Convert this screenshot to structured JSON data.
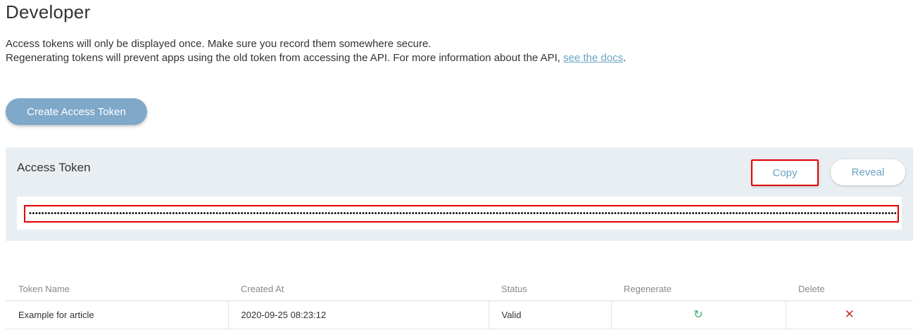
{
  "page": {
    "title": "Developer"
  },
  "intro": {
    "line1": "Access tokens will only be displayed once. Make sure you record them somewhere secure.",
    "line2_prefix": "Regenerating tokens will prevent apps using the old token from accessing the API. For more information about the API, ",
    "docs_link": "see the docs",
    "line2_suffix": "."
  },
  "create_button": {
    "label": "Create Access Token"
  },
  "token_panel": {
    "title": "Access Token",
    "copy_label": "Copy",
    "reveal_label": "Reveal",
    "masked_token": "•••••••••••••••••••••••••••••••••••••••••••••••••••••••••••••••••••••••••••••••••••••••••••••••••••••••••••••••••••••••••••••••••••••••••••••••••••••••••••••••••••••••••••••••••••••••••••••••••••••••••••••••••••••••••••••••••••••••••••••••••••••••••••••••••••••••••••••••••••••••••••••••••••••"
  },
  "table": {
    "headers": [
      "Token Name",
      "Created At",
      "Status",
      "Regenerate",
      "Delete"
    ],
    "rows": [
      {
        "name": "Example for article",
        "created_at": "2020-09-25 08:23:12",
        "status": "Valid",
        "regenerate_icon": "refresh-icon",
        "delete_icon": "close-icon"
      }
    ]
  },
  "colors": {
    "accent": "#6aa3c2",
    "button_bg": "#7fa8c9",
    "panel_bg": "#e9eef2",
    "highlight": "#e00000",
    "regen": "#3fae6a",
    "delete": "#c0392b"
  }
}
